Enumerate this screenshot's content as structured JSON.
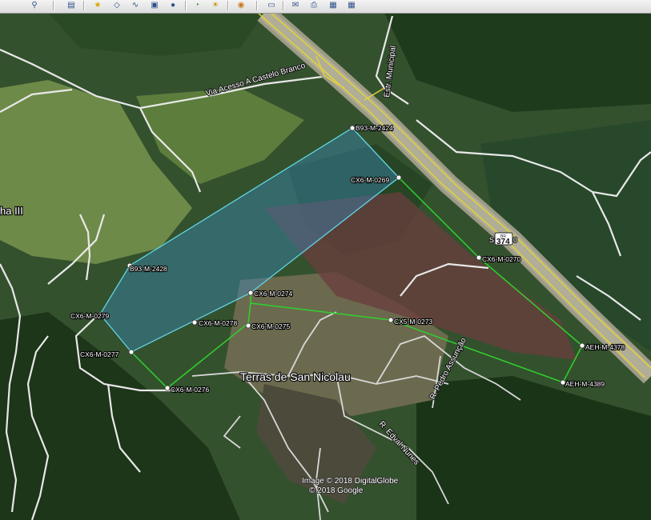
{
  "toolbar": {
    "icons": [
      "search-icon",
      "sidebar-icon",
      "placemark-icon",
      "polygon-icon",
      "path-icon",
      "overlay-icon",
      "tour-icon",
      "history-icon",
      "sun-icon",
      "planets-icon",
      "ruler-icon",
      "email-icon",
      "print-icon",
      "save-image-icon"
    ]
  },
  "map": {
    "place_labels": {
      "terras": "Terras de San Nicolau",
      "left_edge": "ha III"
    },
    "road_labels": {
      "via_acesso": "Via Acesso A Castelo Branco",
      "estr_municipal": "Estr. Municipal",
      "r_pedro": "R. Pedro Assunção",
      "r_edval": "R. Edval Nunes"
    },
    "shield": {
      "top": "BR",
      "number": "374",
      "side_left": "S",
      "side_right": "0"
    },
    "points": [
      "B93-M-2424",
      "CX6-M-0269",
      "CX6-M-0270",
      "B93-M-2428",
      "CX6-M-0274",
      "CX6-M-0279",
      "CX6-M-0278",
      "CX6-M-0275",
      "CX5-M-0273",
      "CX6-M-0277",
      "CX6-M-0276",
      "AEH-M-4378",
      "AEH-M-4389"
    ],
    "copyright": {
      "line1": "Image © 2018 DigitalGlobe",
      "line2": "© 2018 Google"
    },
    "colors": {
      "blue_polygon": "#5fd6e8",
      "green_polygon": "#2fd12f",
      "highway": "#e2d23a"
    }
  }
}
